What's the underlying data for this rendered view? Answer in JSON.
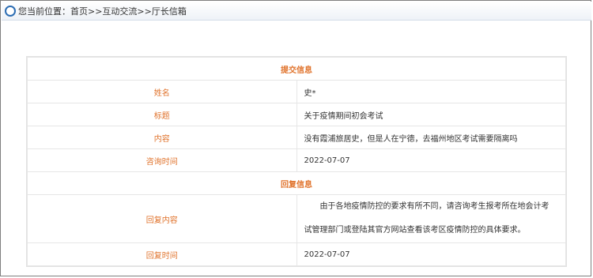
{
  "breadcrumb": {
    "prefix": "您当前位置：",
    "path": "首页>>互动交流>>厅长信箱"
  },
  "submit_section": {
    "title": "提交信息",
    "rows": [
      {
        "label": "姓名",
        "value": "史*"
      },
      {
        "label": "标题",
        "value": "关于疫情期间初会考试"
      },
      {
        "label": "内容",
        "value": "没有霞浦旅居史，但是人在宁德，去福州地区考试需要隔离吗"
      },
      {
        "label": "咨询时间",
        "value": "2022-07-07"
      }
    ]
  },
  "reply_section": {
    "title": "回复信息",
    "content_label": "回复内容",
    "content": "由于各地疫情防控的要求有所不同，请咨询考生报考所在地会计考试管理部门或登陆其官方网站查看该考区疫情防控的具体要求。",
    "time_label": "回复时间",
    "time": "2022-07-07"
  },
  "colors": {
    "accent": "#e0732c",
    "icon": "#2c6db3"
  }
}
